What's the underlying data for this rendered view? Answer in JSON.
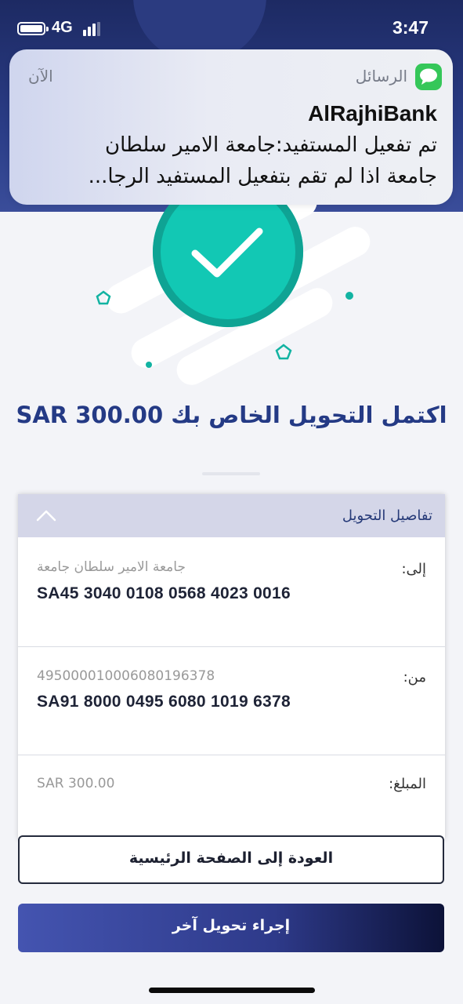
{
  "status_bar": {
    "network": "4G",
    "time": "3:47",
    "battery_icon": "battery-icon",
    "signal_icon": "signal-bars-icon"
  },
  "notification": {
    "app_name": "الرسائل",
    "app_icon": "messages-icon",
    "time_ago": "الآن",
    "sender": "AlRajhiBank",
    "body_line1": "تم تفعيل المستفيد:جامعة الامير سلطان",
    "body_line2": "جامعة اذا لم تقم بتفعيل المستفيد الرجا..."
  },
  "success": {
    "icon": "checkmark-icon",
    "headline": "اكتمل التحويل الخاص بك SAR 300.00",
    "accent_color": "#12c8b4"
  },
  "details": {
    "title": "تفاصيل التحويل",
    "toggle_icon": "chevron-up-icon",
    "to": {
      "label": "إلى:",
      "name": "جامعة الامير سلطان جامعة",
      "iban": "SA45 3040 0108 0568 4023 0016"
    },
    "from": {
      "label": "من:",
      "account": "495000010006080196378",
      "iban": "SA91 8000 0495 6080 1019 6378"
    },
    "amount": {
      "label": "المبلغ:",
      "value": "SAR 300.00"
    }
  },
  "buttons": {
    "home": "العودة إلى الصفحة الرئيسية",
    "another_transfer": "إجراء تحويل آخر"
  },
  "colors": {
    "header_navy": "#1d2a63",
    "headline_blue": "#243a85",
    "card_header": "#d4d6e8"
  }
}
